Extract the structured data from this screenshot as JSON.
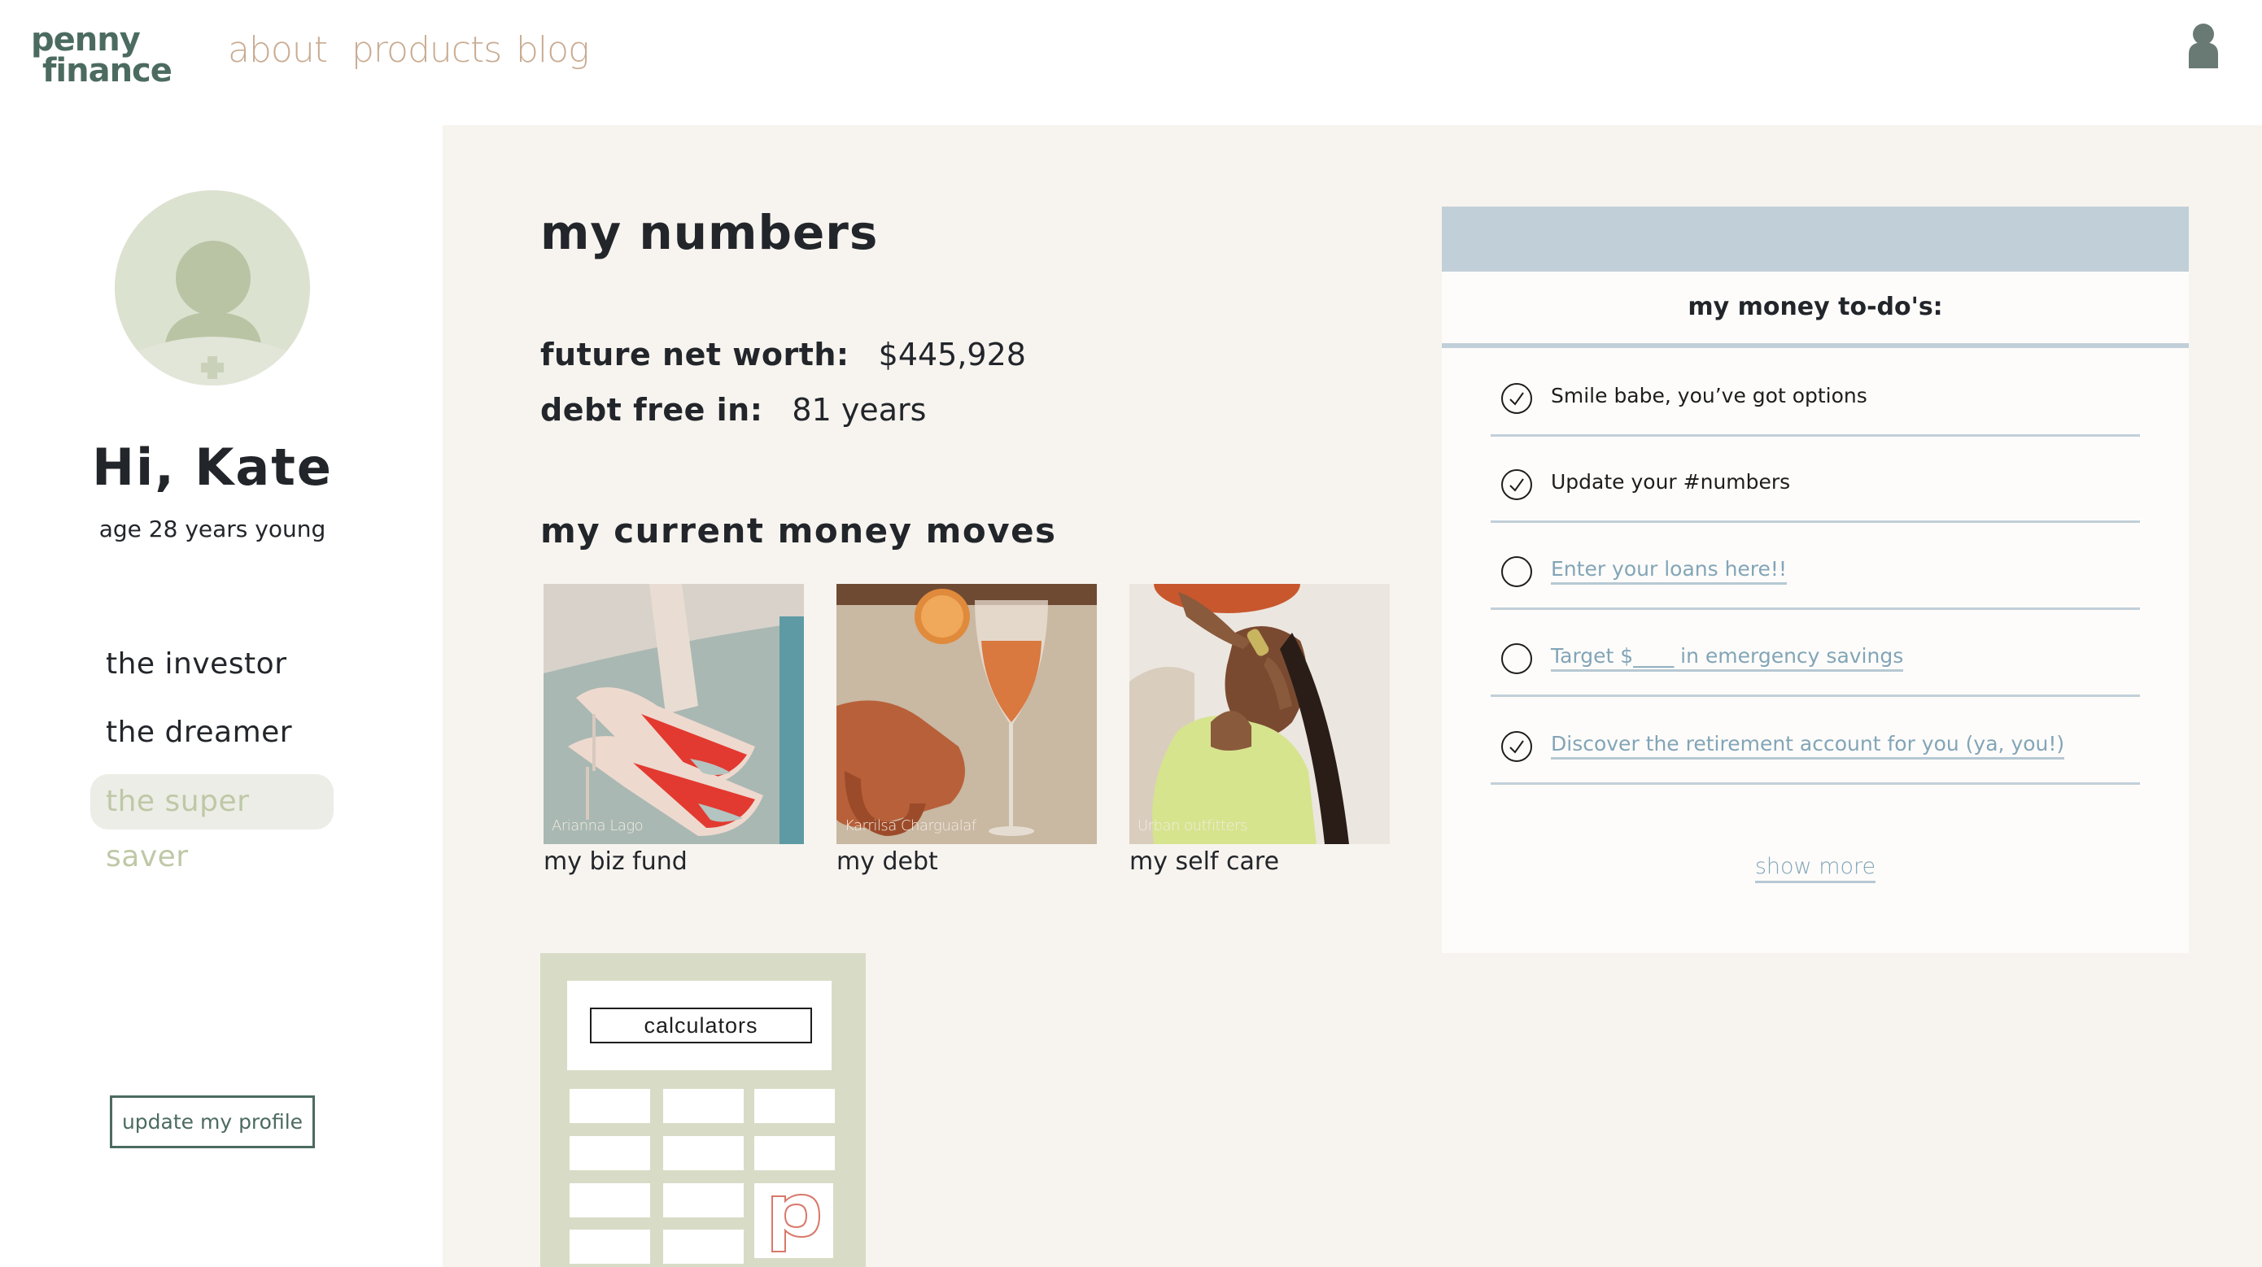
{
  "header": {
    "logo_line1": "penny",
    "logo_line2": "finance",
    "nav": [
      {
        "label": "about"
      },
      {
        "label": "products"
      },
      {
        "label": "blog"
      }
    ],
    "user_icon": "user-icon"
  },
  "sidebar": {
    "avatar_icon": "add-photo-avatar-icon",
    "greeting": "Hi, Kate",
    "age": "age 28 years young",
    "personas": [
      {
        "label": "the investor",
        "active": false
      },
      {
        "label": "the dreamer",
        "active": false
      },
      {
        "label": "the super saver",
        "active": true
      }
    ],
    "update_button": "update my profile"
  },
  "main": {
    "numbers_heading": "my numbers",
    "stats": [
      {
        "label": "future net worth:",
        "value": "$445,928"
      },
      {
        "label": "debt free in:",
        "value": "81 years"
      }
    ],
    "moves_heading": "my current money moves",
    "moves": [
      {
        "caption": "my biz fund",
        "credit": "Arianna Lago",
        "image": "red-sole-heels-photo"
      },
      {
        "caption": "my debt",
        "credit": "Karrilsa Chargualaf",
        "image": "cocktail-and-handbag-photo"
      },
      {
        "caption": "my self care",
        "credit": "Urban outfitters",
        "image": "face-roller-self-care-photo"
      }
    ],
    "calculator": {
      "label": "calculators",
      "icon": "penny-p-logo-icon"
    }
  },
  "todo": {
    "title": "my money to-do's:",
    "items": [
      {
        "text": "Smile babe, you’ve got options",
        "done": true,
        "link": false
      },
      {
        "text": "Update your #numbers",
        "done": true,
        "link": false
      },
      {
        "text": "Enter your loans here!!",
        "done": false,
        "link": true
      },
      {
        "text": "Target $____ in emergency savings",
        "done": false,
        "link": true
      },
      {
        "text": "Discover the retirement account for you (ya, you!)",
        "done": true,
        "link": true
      }
    ],
    "show_more": "show more"
  },
  "colors": {
    "brand_green": "#4c6b60",
    "nav_tan": "#c9ab91",
    "main_bg": "#f7f4ef",
    "todo_blue": "#c1cfd8",
    "link_blue": "#82a5b8",
    "sage": "#d8dcc6",
    "active_persona_text": "#bec8a6",
    "accent_coral": "#d9786a"
  }
}
